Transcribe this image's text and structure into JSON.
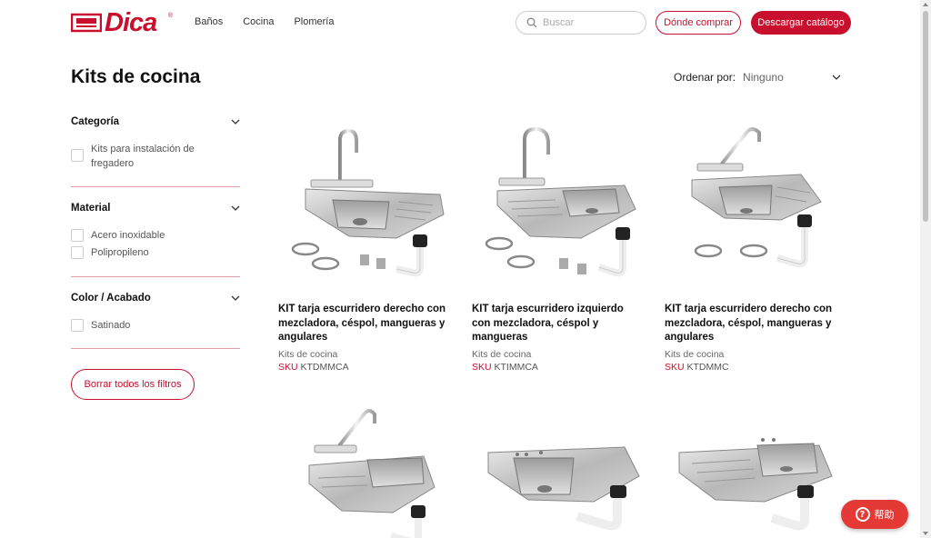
{
  "colors": {
    "brand": "#c8102e",
    "help": "#e53935",
    "divider": "#e2a0a0"
  },
  "header": {
    "logo_text": "Dica",
    "logo_reg": "®",
    "nav": [
      "Baños",
      "Cocina",
      "Plomería"
    ],
    "search_placeholder": "Buscar",
    "where_to_buy": "Dónde comprar",
    "download_catalog": "Descargar catálogo"
  },
  "page": {
    "title": "Kits de cocina",
    "sort_label": "Ordenar por:",
    "sort_value": "Ninguno"
  },
  "filters": [
    {
      "title": "Categoría",
      "options": [
        "Kits para instalación de fregadero"
      ]
    },
    {
      "title": "Material",
      "options": [
        "Acero inoxidable",
        "Polipropileno"
      ]
    },
    {
      "title": "Color / Acabado",
      "options": [
        "Satinado"
      ]
    }
  ],
  "clear_filters": "Borrar todos los filtros",
  "products": [
    {
      "name": "KIT tarja escurridero derecho con mezcladora, céspol, mangueras y angulares",
      "category": "Kits de cocina",
      "sku_label": "SKU",
      "sku": "KTDMMCA"
    },
    {
      "name": "KIT tarja escurridero izquierdo con mezcladora, céspol y mangueras",
      "category": "Kits de cocina",
      "sku_label": "SKU",
      "sku": "KTIMMCA"
    },
    {
      "name": "KIT tarja escurridero derecho con mezcladora, céspol, mangueras y angulares",
      "category": "Kits de cocina",
      "sku_label": "SKU",
      "sku": "KTDMMC"
    }
  ],
  "help_label": "帮助"
}
